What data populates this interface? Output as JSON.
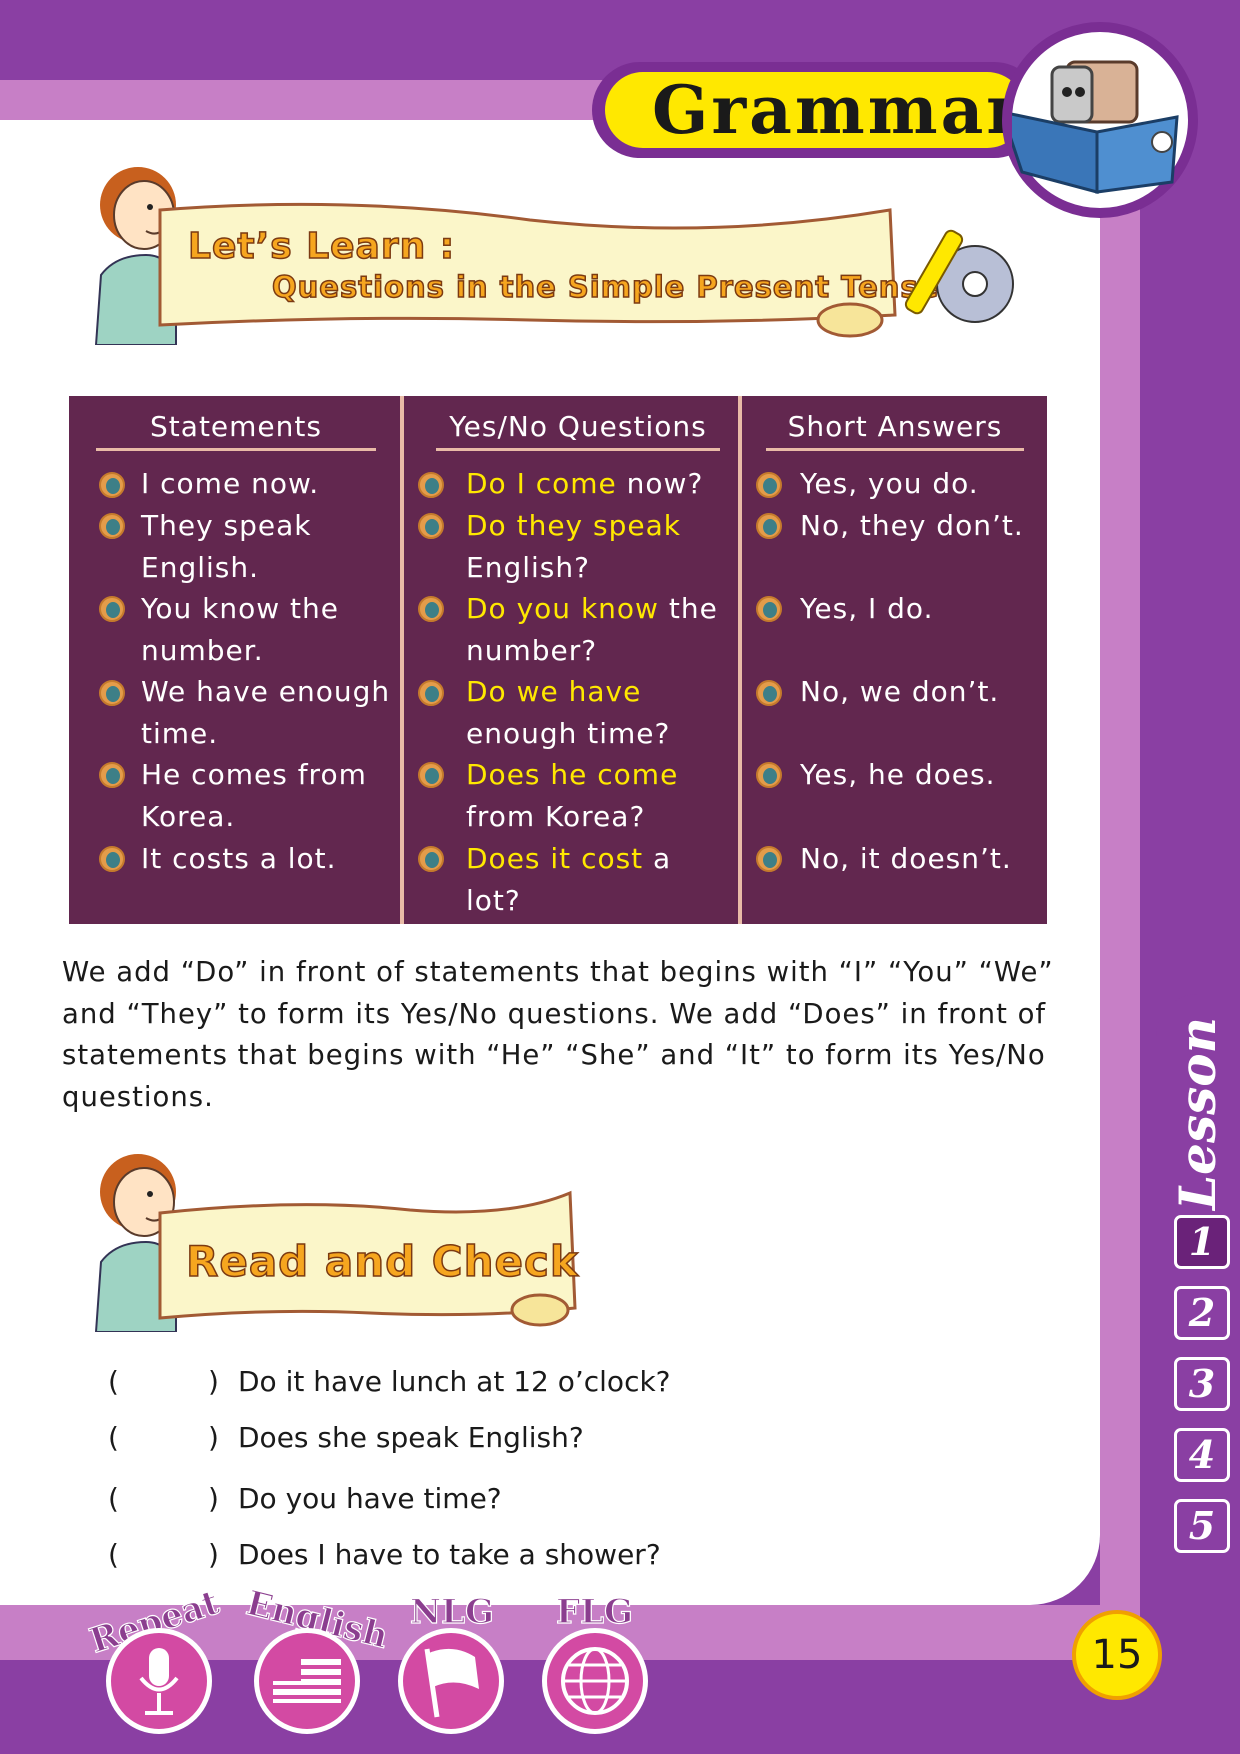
{
  "header": {
    "title": "Grammar"
  },
  "banner_learn": {
    "line1": "Let’s  Learn :",
    "line2": "Questions in the Simple Present Tense"
  },
  "table": {
    "headers": [
      "Statements",
      "Yes/No Questions",
      "Short Answers"
    ],
    "statements": [
      "I come now.",
      "They speak",
      "English.",
      "You know the",
      "number.",
      "We have enough",
      "time.",
      "He comes from",
      "Korea.",
      "It costs a lot."
    ],
    "questions": [
      {
        "hl": "Do I come",
        "rest": " now?"
      },
      {
        "hl": "Do they speak",
        "rest": ""
      },
      {
        "hl": "",
        "rest": "English?"
      },
      {
        "hl": "Do you know",
        "rest": " the"
      },
      {
        "hl": "",
        "rest": "number?"
      },
      {
        "hl": "Do we have",
        "rest": ""
      },
      {
        "hl": "",
        "rest": "enough time?"
      },
      {
        "hl": "Does he come",
        "rest": ""
      },
      {
        "hl": "",
        "rest": "from Korea?"
      },
      {
        "hl": "Does it cost",
        "rest": " a"
      },
      {
        "hl": "",
        "rest": "lot?"
      }
    ],
    "answers": [
      "Yes, you do.",
      "No, they don’t.",
      "Yes, I do.",
      "No, we don’t.",
      "Yes, he does.",
      "No, it doesn’t."
    ]
  },
  "paragraph": "We add “Do” in front of statements that begins with “I” “You” “We” and “They” to form its Yes/No questions. We add “Does” in front of statements that begins with “He” “She” and “It” to form its Yes/No questions.",
  "banner_check": {
    "title": "Read and Check"
  },
  "check_items": [
    {
      "open": "(",
      "close": ")",
      "text": "Do it have lunch at 12 o’clock?"
    },
    {
      "open": "(",
      "close": ")",
      "text": "Does she speak English?"
    },
    {
      "open": "(",
      "close": ")",
      "text": "Do you have time?"
    },
    {
      "open": "(",
      "close": ")",
      "text": "Does I have to take a shower?"
    }
  ],
  "lesson": {
    "label": "Lesson",
    "numbers": [
      "1",
      "2",
      "3",
      "4",
      "5"
    ],
    "active": "1"
  },
  "page_number": "15",
  "bottom_labels": [
    "Repeat",
    "English",
    "NLG",
    "FLG"
  ],
  "colors": {
    "frame": "#8a3fa3",
    "table_bg": "#62274f",
    "highlight": "#ffe800",
    "banner_text": "#f6a61f"
  }
}
